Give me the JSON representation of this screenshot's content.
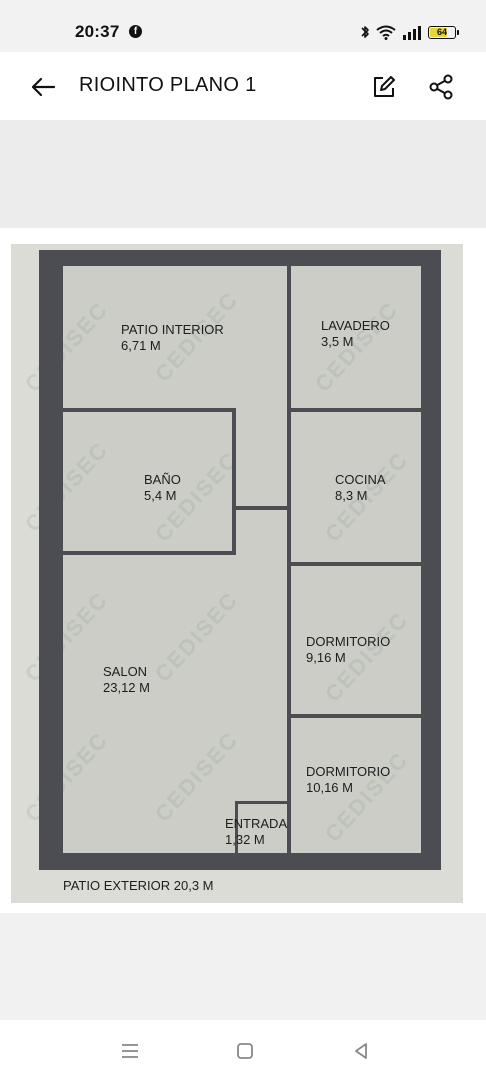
{
  "status_bar": {
    "time": "20:37",
    "notification_icon": "facebook-icon",
    "battery_level": "64",
    "icons": [
      "bluetooth-icon",
      "wifi-icon",
      "signal-icon",
      "battery-icon"
    ]
  },
  "header": {
    "title": "RIOINTO PLANO 1",
    "back_icon": "back-arrow-icon",
    "edit_icon": "edit-icon",
    "share_icon": "share-icon"
  },
  "floor_plan": {
    "rooms": [
      {
        "id": "patio-interior",
        "name": "PATIO INTERIOR",
        "area": "6,71 M"
      },
      {
        "id": "lavadero",
        "name": "LAVADERO",
        "area": "3,5 M"
      },
      {
        "id": "bano",
        "name": "BAÑO",
        "area": "5,4 M"
      },
      {
        "id": "cocina",
        "name": "COCINA",
        "area": "8,3 M"
      },
      {
        "id": "dormitorio-1",
        "name": "DORMITORIO",
        "area": "9,16 M"
      },
      {
        "id": "salon",
        "name": "SALON",
        "area": "23,12 M"
      },
      {
        "id": "dormitorio-2",
        "name": "DORMITORIO",
        "area": "10,16 M"
      },
      {
        "id": "entrada",
        "name": "ENTRADA",
        "area": "1,32 M"
      }
    ],
    "exterior_label": "PATIO EXTERIOR 20,3 M",
    "watermark": "CEDISEC"
  },
  "nav_bar": {
    "icons": [
      "recents-icon",
      "home-icon",
      "back-icon"
    ]
  },
  "colors": {
    "wall": "#4b4d52",
    "floor": "#cdcdc8",
    "app_bar": "#ffffff",
    "battery_fill": "#e6d438"
  }
}
